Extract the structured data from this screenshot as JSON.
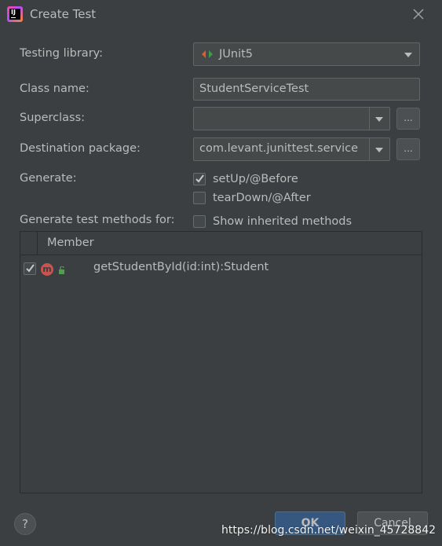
{
  "window": {
    "title": "Create Test"
  },
  "form": {
    "testing_library": {
      "label": "Testing library:",
      "value": "JUnit5"
    },
    "class_name": {
      "label": "Class name:",
      "value": "StudentServiceTest"
    },
    "superclass": {
      "label": "Superclass:",
      "value": "",
      "browse": "..."
    },
    "destination_package": {
      "label": "Destination package:",
      "value": "com.levant.junittest.service",
      "browse": "..."
    },
    "generate": {
      "label": "Generate:",
      "options": [
        {
          "label": "setUp/@Before",
          "checked": true
        },
        {
          "label": "tearDown/@After",
          "checked": false
        }
      ]
    },
    "test_methods": {
      "label": "Generate test methods for:",
      "show_inherited": {
        "label": "Show inherited methods",
        "checked": false
      }
    }
  },
  "table": {
    "header": "Member",
    "rows": [
      {
        "checked": true,
        "icon": "m",
        "member": "getStudentById(id:int):Student"
      }
    ]
  },
  "footer": {
    "help": "?",
    "ok": "OK",
    "cancel": "Cancel"
  },
  "watermark": "https://blog.csdn.net/weixin_45728842",
  "colors": {
    "background": "#3c3f41",
    "field": "#45494a",
    "ok_button": "#365880",
    "method_icon": "#c75450"
  }
}
